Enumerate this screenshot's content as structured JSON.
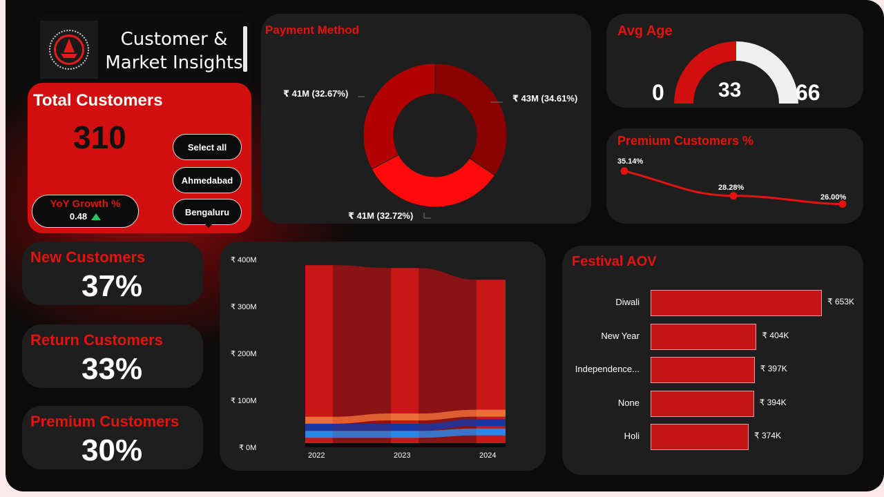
{
  "header": {
    "title": "Customer & Market Insights"
  },
  "total_customers": {
    "label": "Total Customers",
    "value": "310"
  },
  "yoy": {
    "label": "YoY Growth %",
    "value": "0.48"
  },
  "slicer": {
    "options": [
      "Select all",
      "Ahmedabad",
      "Bengaluru"
    ]
  },
  "kpis": [
    {
      "label": "New Customers",
      "value": "37%"
    },
    {
      "label": "Return Customers",
      "value": "33%"
    },
    {
      "label": "Premium Customers",
      "value": "30%"
    }
  ],
  "payment_method": {
    "title": "Payment Method",
    "labels": [
      "₹ 43M (34.61%)",
      "₹ 41M (32.72%)",
      "₹ 41M (32.67%)"
    ]
  },
  "avg_age": {
    "title": "Avg Age",
    "min": "0",
    "value": "33",
    "max": "66"
  },
  "premium_pct": {
    "title": "Premium Customers %",
    "labels": [
      "35.14%",
      "28.28%",
      "26.00%"
    ]
  },
  "festival_aov": {
    "title": "Festival AOV",
    "value_labels": [
      "₹ 653K",
      "₹ 404K",
      "₹ 397K",
      "₹ 394K",
      "₹ 374K"
    ]
  },
  "ribbon": {
    "y_ticks": [
      "₹ 400M",
      "₹ 300M",
      "₹ 200M",
      "₹ 100M",
      "₹ 0M"
    ],
    "x_labels": [
      "2022",
      "2023",
      "2024"
    ]
  },
  "colors": {
    "accent": "#e3140f",
    "card": "#1e1e1e",
    "dark_red": "#8b0000",
    "bright_red": "#ff0a0a"
  },
  "chart_data": [
    {
      "type": "pie",
      "title": "Payment Method",
      "values": [
        43,
        41,
        41
      ],
      "percentages": [
        34.61,
        32.72,
        32.67
      ],
      "colors": [
        "#8b0000",
        "#ff0a0a",
        "#b30000"
      ]
    },
    {
      "type": "line",
      "title": "Premium Customers %",
      "values": [
        35.14,
        28.28,
        26.0
      ]
    },
    {
      "type": "bar",
      "title": "Festival AOV",
      "categories": [
        "Diwali",
        "New Year",
        "Independence...",
        "None",
        "Holi"
      ],
      "values": [
        653,
        404,
        397,
        394,
        374
      ]
    },
    {
      "type": "area",
      "x": [
        "2022",
        "2023",
        "2024"
      ],
      "ylim": [
        0,
        400
      ],
      "series": [
        {
          "values": [
            388,
            382,
            357
          ],
          "color": "#c91717"
        },
        {
          "values": [
            65,
            72,
            80
          ],
          "color": "#ec6d38"
        },
        {
          "values": [
            50,
            50,
            60
          ],
          "color": "#1936a3"
        },
        {
          "values": [
            35,
            35,
            40
          ],
          "color": "#2a86e8"
        }
      ]
    }
  ]
}
